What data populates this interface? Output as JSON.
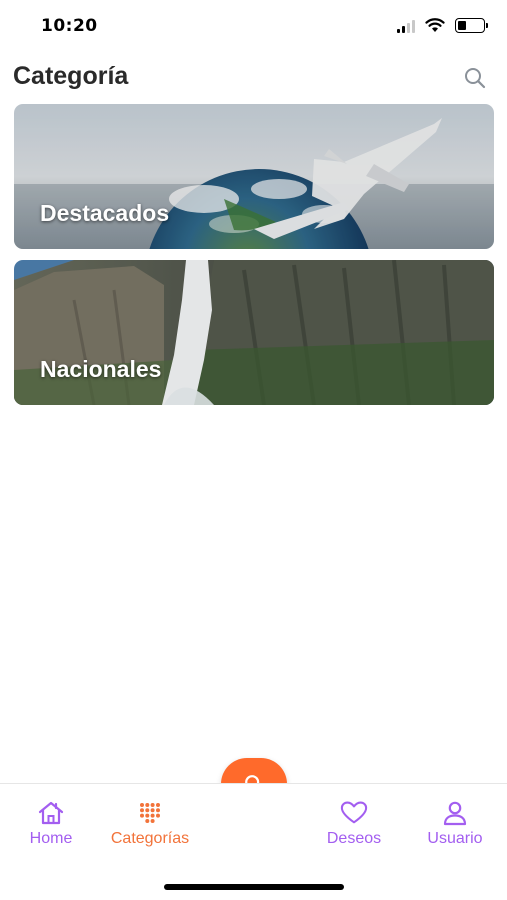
{
  "status_bar": {
    "time": "10:20",
    "battery_level": 0.35,
    "icons": [
      "signal-icon",
      "wifi-icon",
      "battery-icon"
    ]
  },
  "header": {
    "title": "Categoría",
    "search_icon": "search-icon"
  },
  "categories": [
    {
      "label": "Destacados",
      "image": "earth-with-airplane"
    },
    {
      "label": "Nacionales",
      "image": "waterfall-cliffs"
    }
  ],
  "bottom_nav": {
    "items": [
      {
        "label": "Home",
        "icon": "home-icon",
        "active": false
      },
      {
        "label": "Categorías",
        "icon": "grid-dots-icon",
        "active": true
      },
      {
        "label": "Deseos",
        "icon": "heart-icon",
        "active": false
      },
      {
        "label": "Usuario",
        "icon": "user-icon",
        "active": false
      }
    ],
    "fab_icon": "search-icon"
  },
  "colors": {
    "accent_orange": "#ff6a2b",
    "nav_purple": "#a35ef0",
    "active_orange": "#f2733a"
  }
}
